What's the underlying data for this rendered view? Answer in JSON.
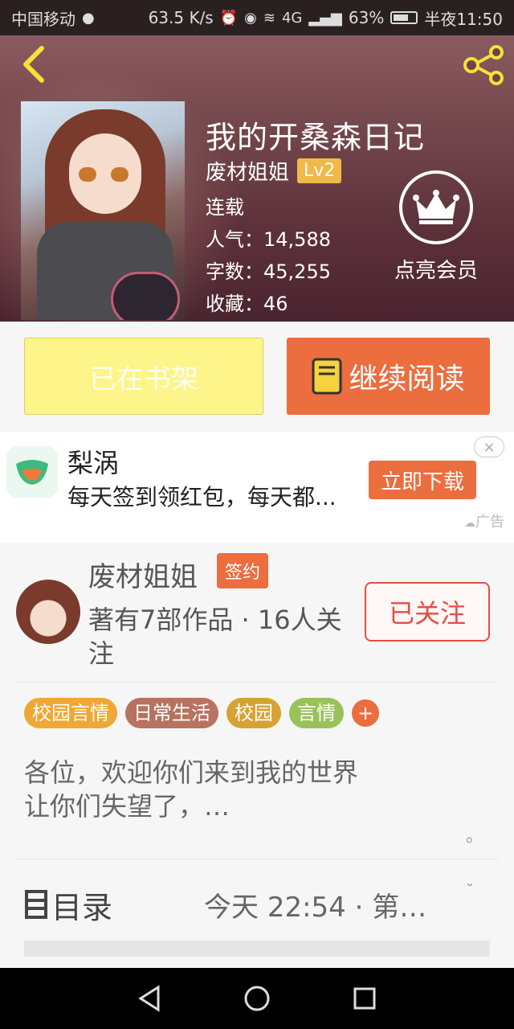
{
  "status_bar": {
    "carrier": "中国移动",
    "speed": "63.5 K/s",
    "network": "4G",
    "battery": "63%",
    "time": "半夜11:50"
  },
  "book": {
    "title": "我的开桑森日记",
    "author": "废材姐姐",
    "level": "Lv2",
    "status": "连载",
    "popularity_label": "人气：",
    "popularity": "14,588",
    "words_label": "字数：",
    "words": "45,255",
    "favorites_label": "收藏：",
    "favorites": "46",
    "vip_label": "点亮会员"
  },
  "actions": {
    "shelf_label": "已在书架",
    "read_label": "继续阅读"
  },
  "ad": {
    "title": "梨涡",
    "desc": "每天签到领红包，每天都...",
    "button": "立即下载",
    "close": "×",
    "tag": "广告"
  },
  "author_card": {
    "name": "废材姐姐",
    "badge": "签约",
    "works": "著有7部作品 · 16人关注",
    "follow_label": "已关注",
    "tags": [
      {
        "label": "校园言情",
        "color": "#f1a735"
      },
      {
        "label": "日常生活",
        "color": "#b87260"
      },
      {
        "label": "校园",
        "color": "#d6a234"
      },
      {
        "label": "言情",
        "color": "#99c25a"
      }
    ],
    "add_tag": "+",
    "intro": "各位，欢迎你们来到我的世界\n让你们失望了，…",
    "intro_end": "。"
  },
  "toc": {
    "label": "目录",
    "latest": "今天 22:54 · 第…"
  },
  "colors": {
    "accent": "#ec6d3e",
    "shelf_yellow": "#fdf589",
    "follow_red": "#e44d45",
    "lv_gold": "#f1b84a"
  }
}
